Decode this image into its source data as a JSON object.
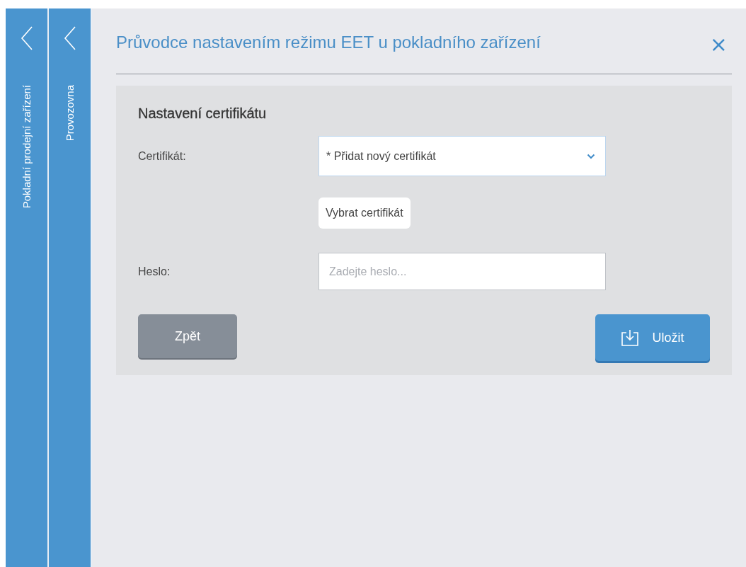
{
  "side_panels": [
    {
      "label": "Pokladní prodejní zařízení"
    },
    {
      "label": "Provozovna"
    }
  ],
  "dialog": {
    "title": "Průvodce nastavením režimu EET u pokladního zařízení",
    "close": "×",
    "section": {
      "heading": "Nastavení certifikátu",
      "rows": [
        {
          "kind": "select",
          "label": "Certifikát:",
          "value": "* Přidat nový certifikát"
        },
        {
          "kind": "button",
          "label": "Vybrat certifikát"
        },
        {
          "kind": "password",
          "label": "Heslo:",
          "placeholder": "Zadejte heslo..."
        }
      ]
    },
    "buttons": [
      {
        "kind": "back",
        "label": "Zpět"
      },
      {
        "kind": "save",
        "label": "Uložit"
      }
    ]
  }
}
